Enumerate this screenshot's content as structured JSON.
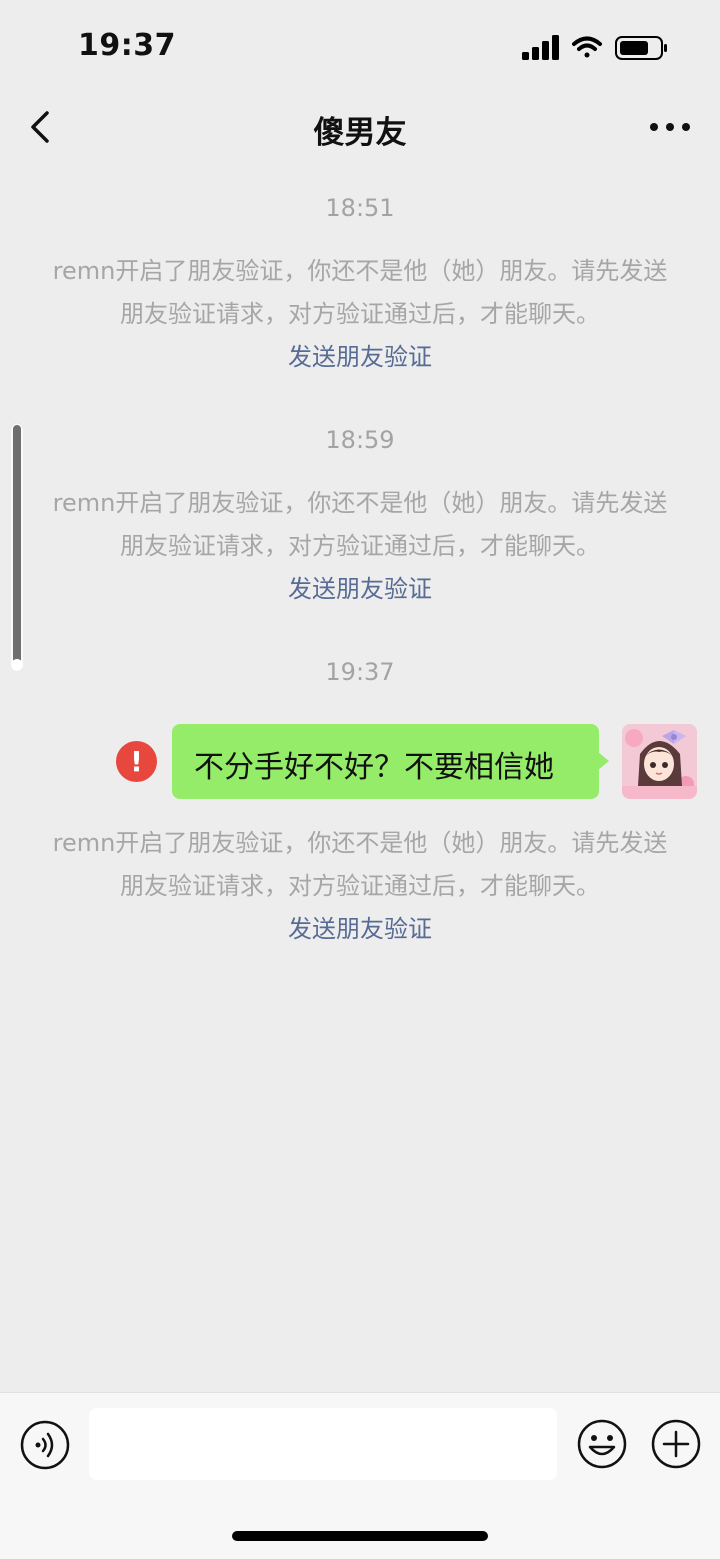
{
  "status_bar": {
    "time": "19:37"
  },
  "nav": {
    "title": "傻男友"
  },
  "conversation": {
    "blocks": [
      {
        "time": "18:51",
        "system_text": "remn开启了朋友验证，你还不是他（她）朋友。请先发送朋友验证请求，对方验证通过后，才能聊天。",
        "link": "发送朋友验证"
      },
      {
        "time": "18:59",
        "system_text": "remn开启了朋友验证，你还不是他（她）朋友。请先发送朋友验证请求，对方验证通过后，才能聊天。",
        "link": "发送朋友验证"
      },
      {
        "time": "19:37"
      }
    ],
    "outgoing_message": {
      "text": "不分手好不好？不要相信她",
      "error_symbol": "!"
    },
    "after_message": {
      "system_text": "remn开启了朋友验证，你还不是他（她）朋友。请先发送朋友验证请求，对方验证通过后，才能聊天。",
      "link": "发送朋友验证"
    }
  },
  "input_bar": {
    "value": "",
    "placeholder": ""
  },
  "colors": {
    "background": "#ededed",
    "bubble": "#95ec69",
    "link": "#576b95",
    "system_text": "#a6a6a6",
    "error": "#e7473d"
  },
  "icons": [
    "back-icon",
    "more-icon",
    "voice-icon",
    "emoji-icon",
    "plus-icon",
    "error-icon",
    "wifi-icon",
    "signal-icon",
    "battery-icon"
  ]
}
